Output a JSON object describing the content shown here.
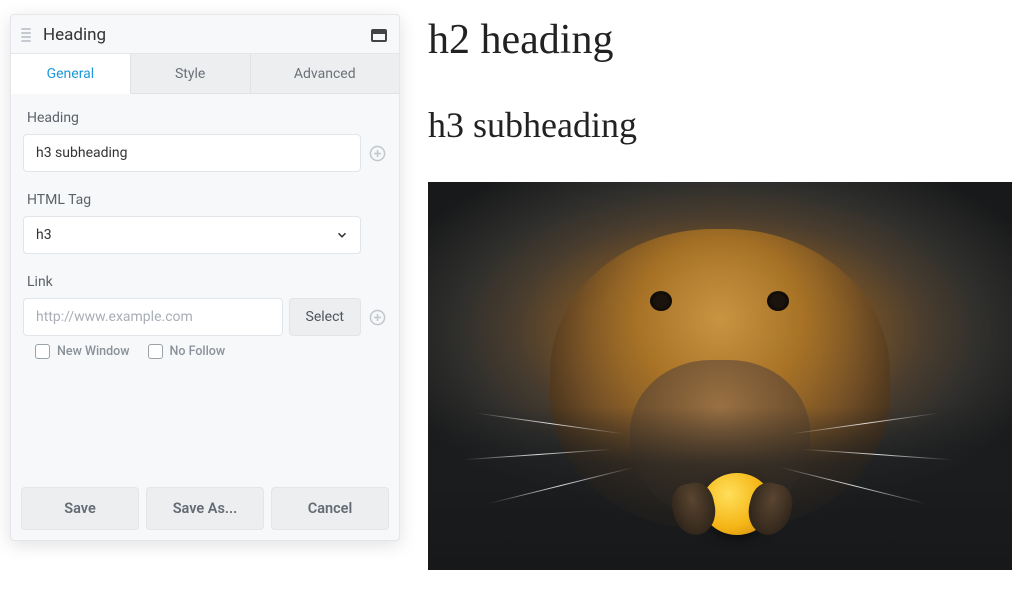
{
  "panel": {
    "title": "Heading",
    "tabs": {
      "general": "General",
      "style": "Style",
      "advanced": "Advanced"
    },
    "fields": {
      "heading": {
        "label": "Heading",
        "value": "h3 subheading"
      },
      "html_tag": {
        "label": "HTML Tag",
        "value": "h3"
      },
      "link": {
        "label": "Link",
        "placeholder": "http://www.example.com",
        "value": "",
        "select_button": "Select",
        "new_window": {
          "label": "New Window",
          "checked": false
        },
        "no_follow": {
          "label": "No Follow",
          "checked": false
        }
      }
    },
    "footer": {
      "save": "Save",
      "save_as": "Save As...",
      "cancel": "Cancel"
    }
  },
  "preview": {
    "h2": "h2 heading",
    "h3": "h3 subheading",
    "image_alt": "beaver-photo"
  }
}
